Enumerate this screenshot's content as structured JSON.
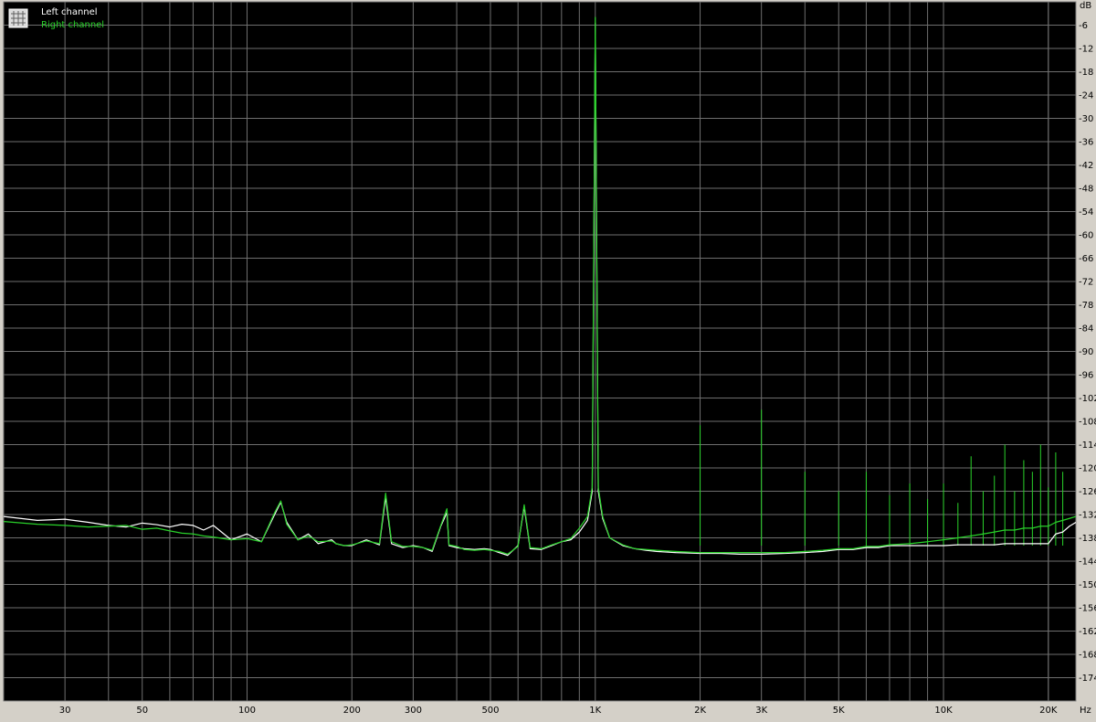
{
  "chart_data": {
    "type": "line",
    "x_unit": "Hz",
    "y_unit": "dB",
    "x_scale": "log",
    "xlim": [
      20,
      24000
    ],
    "ylim": [
      -180,
      0
    ],
    "grid": true,
    "legend_position": "top-left",
    "x_ticks": [
      {
        "value": 30,
        "label": "30"
      },
      {
        "value": 50,
        "label": "50"
      },
      {
        "value": 100,
        "label": "100"
      },
      {
        "value": 200,
        "label": "200"
      },
      {
        "value": 300,
        "label": "300"
      },
      {
        "value": 500,
        "label": "500"
      },
      {
        "value": 1000,
        "label": "1K"
      },
      {
        "value": 2000,
        "label": "2K"
      },
      {
        "value": 3000,
        "label": "3K"
      },
      {
        "value": 5000,
        "label": "5K"
      },
      {
        "value": 10000,
        "label": "10K"
      },
      {
        "value": 20000,
        "label": "20K"
      }
    ],
    "y_ticks": [
      -6,
      -12,
      -18,
      -24,
      -30,
      -36,
      -42,
      -48,
      -54,
      -60,
      -66,
      -72,
      -78,
      -84,
      -90,
      -96,
      -102,
      -108,
      -114,
      -120,
      -126,
      -132,
      -138,
      -144,
      -150,
      -156,
      -162,
      -168,
      -174
    ],
    "series": [
      {
        "name": "Left channel",
        "color": "#ffffff",
        "x": [
          20,
          25,
          30,
          35,
          40,
          45,
          50,
          55,
          60,
          65,
          70,
          75,
          80,
          90,
          100,
          110,
          120,
          125,
          130,
          140,
          150,
          160,
          175,
          180,
          190,
          200,
          220,
          240,
          250,
          260,
          280,
          300,
          320,
          340,
          360,
          375,
          380,
          400,
          420,
          450,
          480,
          500,
          530,
          560,
          600,
          625,
          650,
          700,
          750,
          800,
          850,
          900,
          950,
          980,
          1000,
          1020,
          1050,
          1100,
          1200,
          1300,
          1400,
          1500,
          1700,
          2000,
          2300,
          2600,
          3000,
          3500,
          4000,
          4500,
          5000,
          5500,
          6000,
          6500,
          7000,
          8000,
          9000,
          10000,
          11000,
          12000,
          13000,
          14000,
          15000,
          16000,
          17000,
          18000,
          19000,
          20000,
          21000,
          22000,
          23000,
          24000
        ],
        "y": [
          -132.5,
          -133.5,
          -133.2,
          -134.0,
          -134.8,
          -135.2,
          -134.2,
          -134.6,
          -135.2,
          -134.5,
          -134.8,
          -136.0,
          -134.8,
          -138.5,
          -137.0,
          -139.0,
          -132.0,
          -128.8,
          -134.0,
          -138.5,
          -137.0,
          -139.5,
          -138.5,
          -139.5,
          -140.0,
          -140.0,
          -138.5,
          -139.8,
          -127.5,
          -139.5,
          -140.5,
          -140.0,
          -140.5,
          -141.5,
          -135.0,
          -131.5,
          -140.0,
          -140.5,
          -140.8,
          -141.0,
          -140.8,
          -141.0,
          -141.8,
          -142.5,
          -140.0,
          -130.0,
          -140.8,
          -141.0,
          -140.0,
          -139.0,
          -138.5,
          -136.5,
          -133.5,
          -126.0,
          -5.5,
          -126.0,
          -133.0,
          -138.0,
          -140.0,
          -140.8,
          -141.2,
          -141.5,
          -141.8,
          -142.0,
          -142.0,
          -142.2,
          -142.2,
          -142.0,
          -141.8,
          -141.5,
          -141.0,
          -141.0,
          -140.5,
          -140.5,
          -140.0,
          -140.0,
          -140.0,
          -140.0,
          -139.8,
          -139.8,
          -139.8,
          -139.8,
          -139.5,
          -139.5,
          -139.5,
          -139.5,
          -139.5,
          -139.5,
          -137.0,
          -136.5,
          -135.0,
          -134.0
        ]
      },
      {
        "name": "Right channel",
        "color": "#29d12a",
        "x": [
          20,
          25,
          30,
          35,
          40,
          45,
          50,
          55,
          60,
          65,
          70,
          75,
          80,
          90,
          100,
          110,
          120,
          125,
          130,
          140,
          150,
          160,
          175,
          180,
          190,
          200,
          220,
          240,
          250,
          260,
          280,
          300,
          320,
          340,
          360,
          375,
          380,
          400,
          420,
          450,
          480,
          500,
          530,
          560,
          600,
          625,
          650,
          700,
          750,
          800,
          850,
          900,
          950,
          980,
          1000,
          1020,
          1050,
          1100,
          1200,
          1300,
          1400,
          1500,
          1700,
          2000,
          2300,
          2600,
          3000,
          3500,
          4000,
          4500,
          5000,
          5500,
          6000,
          6500,
          7000,
          8000,
          9000,
          10000,
          11000,
          12000,
          13000,
          14000,
          15000,
          16000,
          17000,
          18000,
          19000,
          20000,
          21000,
          22000,
          23000,
          24000
        ],
        "y": [
          -133.8,
          -134.5,
          -134.8,
          -135.2,
          -135.0,
          -134.8,
          -135.8,
          -135.5,
          -136.2,
          -136.8,
          -137.0,
          -137.5,
          -137.8,
          -138.5,
          -138.2,
          -139.0,
          -131.5,
          -128.5,
          -134.5,
          -138.5,
          -137.5,
          -139.0,
          -138.8,
          -139.5,
          -140.0,
          -139.8,
          -138.8,
          -139.5,
          -126.5,
          -139.0,
          -140.2,
          -140.2,
          -140.5,
          -141.2,
          -134.8,
          -130.5,
          -139.8,
          -140.2,
          -141.0,
          -141.2,
          -141.0,
          -141.2,
          -141.5,
          -142.2,
          -140.2,
          -129.5,
          -140.5,
          -140.8,
          -139.8,
          -139.0,
          -138.2,
          -135.5,
          -132.5,
          -125.0,
          -4.0,
          -125.0,
          -132.5,
          -138.0,
          -139.8,
          -140.8,
          -141.0,
          -141.2,
          -141.5,
          -141.8,
          -141.8,
          -141.8,
          -141.8,
          -141.8,
          -141.5,
          -141.2,
          -140.8,
          -140.8,
          -140.2,
          -140.2,
          -139.8,
          -139.5,
          -139.0,
          -138.5,
          -138.0,
          -137.5,
          -137.0,
          -136.5,
          -136.0,
          -136.0,
          -135.5,
          -135.5,
          -135.0,
          -135.0,
          -134.0,
          -133.5,
          -133.0,
          -132.5
        ]
      }
    ],
    "spikes": {
      "color": "#29d12a",
      "base": -140,
      "points": [
        {
          "x": 2000,
          "y": -109
        },
        {
          "x": 3000,
          "y": -105
        },
        {
          "x": 4000,
          "y": -121
        },
        {
          "x": 5000,
          "y": -126
        },
        {
          "x": 6000,
          "y": -121
        },
        {
          "x": 7000,
          "y": -127
        },
        {
          "x": 8000,
          "y": -124
        },
        {
          "x": 9000,
          "y": -128
        },
        {
          "x": 10000,
          "y": -124
        },
        {
          "x": 11000,
          "y": -129
        },
        {
          "x": 12000,
          "y": -117
        },
        {
          "x": 13000,
          "y": -126
        },
        {
          "x": 14000,
          "y": -122
        },
        {
          "x": 15000,
          "y": -114
        },
        {
          "x": 16000,
          "y": -126
        },
        {
          "x": 17000,
          "y": -118
        },
        {
          "x": 18000,
          "y": -121
        },
        {
          "x": 19000,
          "y": -114
        },
        {
          "x": 20000,
          "y": -125
        },
        {
          "x": 21000,
          "y": -116
        },
        {
          "x": 22000,
          "y": -121
        }
      ]
    }
  }
}
